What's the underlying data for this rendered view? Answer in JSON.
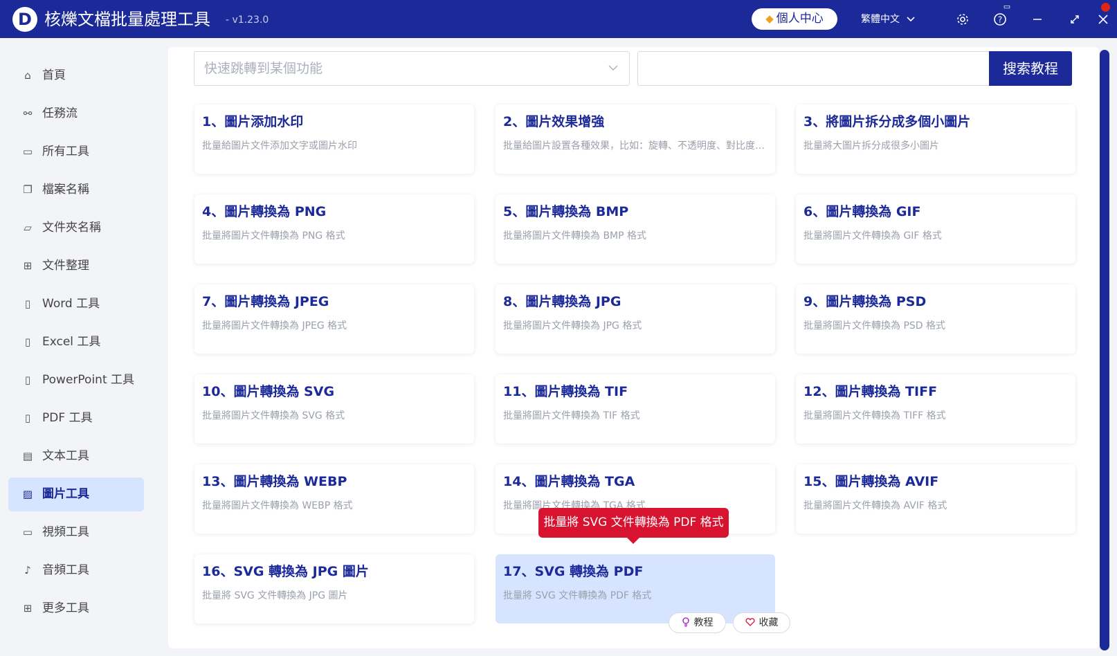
{
  "titlebar": {
    "logo_letter": "D",
    "title": "核爍文檔批量處理工具",
    "version": "- v1.23.0",
    "user_center": "個人中心",
    "language": "繁體中文"
  },
  "sidebar": {
    "items": [
      {
        "label": "首頁",
        "icon": "home-icon"
      },
      {
        "label": "任務流",
        "icon": "workflow-icon"
      },
      {
        "label": "所有工具",
        "icon": "monitor-icon"
      },
      {
        "label": "檔案名稱",
        "icon": "file-copy-icon"
      },
      {
        "label": "文件夾名稱",
        "icon": "folder-icon"
      },
      {
        "label": "文件整理",
        "icon": "organize-icon"
      },
      {
        "label": "Word 工具",
        "icon": "word-icon"
      },
      {
        "label": "Excel 工具",
        "icon": "excel-icon"
      },
      {
        "label": "PowerPoint 工具",
        "icon": "powerpoint-icon"
      },
      {
        "label": "PDF 工具",
        "icon": "pdf-icon"
      },
      {
        "label": "文本工具",
        "icon": "text-icon"
      },
      {
        "label": "圖片工具",
        "icon": "image-icon",
        "active": true
      },
      {
        "label": "視頻工具",
        "icon": "video-icon"
      },
      {
        "label": "音頻工具",
        "icon": "microphone-icon"
      },
      {
        "label": "更多工具",
        "icon": "grid-icon"
      }
    ]
  },
  "search": {
    "jump_placeholder": "快速跳轉到某個功能",
    "search_value": "",
    "search_button": "搜索教程"
  },
  "cards": [
    {
      "title": "1、圖片添加水印",
      "desc": "批量給圖片文件添加文字或圖片水印"
    },
    {
      "title": "2、圖片效果增強",
      "desc": "批量給圖片設置各種效果，比如：旋轉、不透明度、對比度、亮度等"
    },
    {
      "title": "3、將圖片拆分成多個小圖片",
      "desc": "批量將大圖片拆分成很多小圖片"
    },
    {
      "title": "4、圖片轉換為 PNG",
      "desc": "批量將圖片文件轉換為 PNG 格式"
    },
    {
      "title": "5、圖片轉換為 BMP",
      "desc": "批量將圖片文件轉換為 BMP 格式"
    },
    {
      "title": "6、圖片轉換為 GIF",
      "desc": "批量將圖片文件轉換為 GIF 格式"
    },
    {
      "title": "7、圖片轉換為 JPEG",
      "desc": "批量將圖片文件轉換為 JPEG 格式"
    },
    {
      "title": "8、圖片轉換為 JPG",
      "desc": "批量將圖片文件轉換為 JPG 格式"
    },
    {
      "title": "9、圖片轉換為 PSD",
      "desc": "批量將圖片文件轉換為 PSD 格式"
    },
    {
      "title": "10、圖片轉換為 SVG",
      "desc": "批量將圖片文件轉換為 SVG 格式"
    },
    {
      "title": "11、圖片轉換為 TIF",
      "desc": "批量將圖片文件轉換為 TIF 格式"
    },
    {
      "title": "12、圖片轉換為 TIFF",
      "desc": "批量將圖片文件轉換為 TIFF 格式"
    },
    {
      "title": "13、圖片轉換為 WEBP",
      "desc": "批量將圖片文件轉換為 WEBP 格式"
    },
    {
      "title": "14、圖片轉換為 TGA",
      "desc": "批量將圖片文件轉換為 TGA 格式"
    },
    {
      "title": "15、圖片轉換為 AVIF",
      "desc": "批量將圖片文件轉換為 AVIF 格式"
    },
    {
      "title": "16、SVG 轉換為 JPG 圖片",
      "desc": "批量將 SVG 文件轉換為 JPG 圖片"
    },
    {
      "title": "17、SVG 轉換為 PDF",
      "desc": "批量將 SVG 文件轉換為 PDF 格式",
      "selected": true
    }
  ],
  "tooltip": "批量將 SVG 文件轉換為 PDF 格式",
  "actions": {
    "tutorial": "教程",
    "favorite": "收藏"
  },
  "colors": {
    "brand": "#1c2a99",
    "active_nav_bg": "#d7e4ff",
    "selected_card_bg": "#d6e4ff",
    "tooltip": "#d8132f",
    "gem": "#f0a020"
  }
}
